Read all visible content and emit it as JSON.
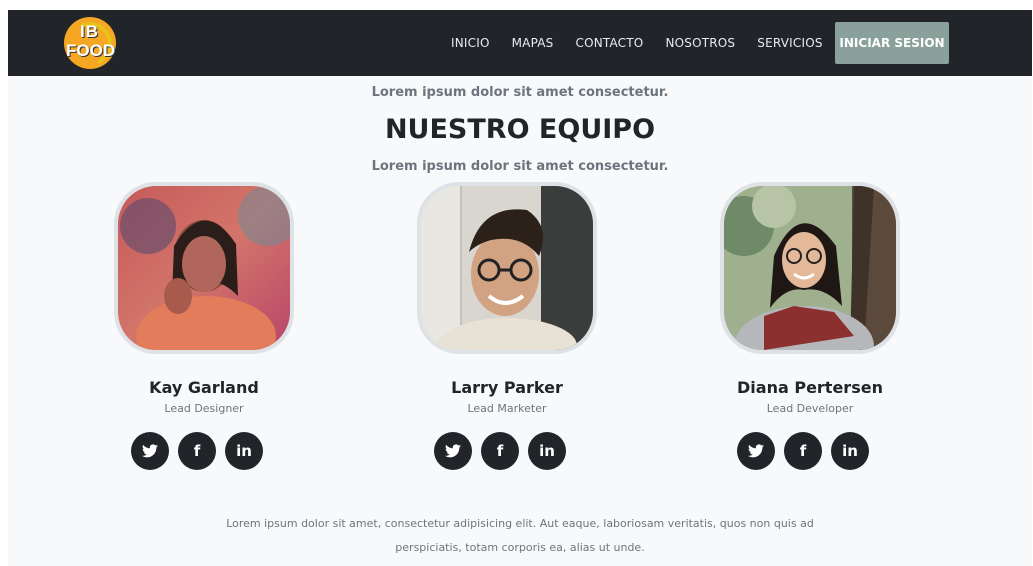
{
  "brand": {
    "logo_line1": "IB",
    "logo_line2": "FOOD"
  },
  "nav": {
    "items": [
      "INICIO",
      "MAPAS",
      "CONTACTO",
      "NOSOTROS",
      "SERVICIOS"
    ],
    "login_label": "INICIAR SESION"
  },
  "section": {
    "kicker_top": "Lorem ipsum dolor sit amet consectetur.",
    "title": "NUESTRO EQUIPO",
    "kicker_bottom": "Lorem ipsum dolor sit amet consectetur."
  },
  "team": [
    {
      "name": "Kay Garland",
      "role": "Lead Designer"
    },
    {
      "name": "Larry Parker",
      "role": "Lead Marketer"
    },
    {
      "name": "Diana Pertersen",
      "role": "Lead Developer"
    }
  ],
  "social_icons": {
    "twitter": "twitter-icon",
    "facebook": "facebook-icon",
    "linkedin": "linkedin-icon",
    "facebook_glyph": "f",
    "linkedin_glyph": "in"
  },
  "footer": {
    "text": "Lorem ipsum dolor sit amet, consectetur adipisicing elit. Aut eaque, laboriosam veritatis, quos non quis ad perspiciatis, totam corporis ea, alias ut unde."
  },
  "colors": {
    "navbar": "#212529",
    "login_button": "#8aa19b",
    "background": "#f8f9fa",
    "logo": "#f5a623"
  }
}
